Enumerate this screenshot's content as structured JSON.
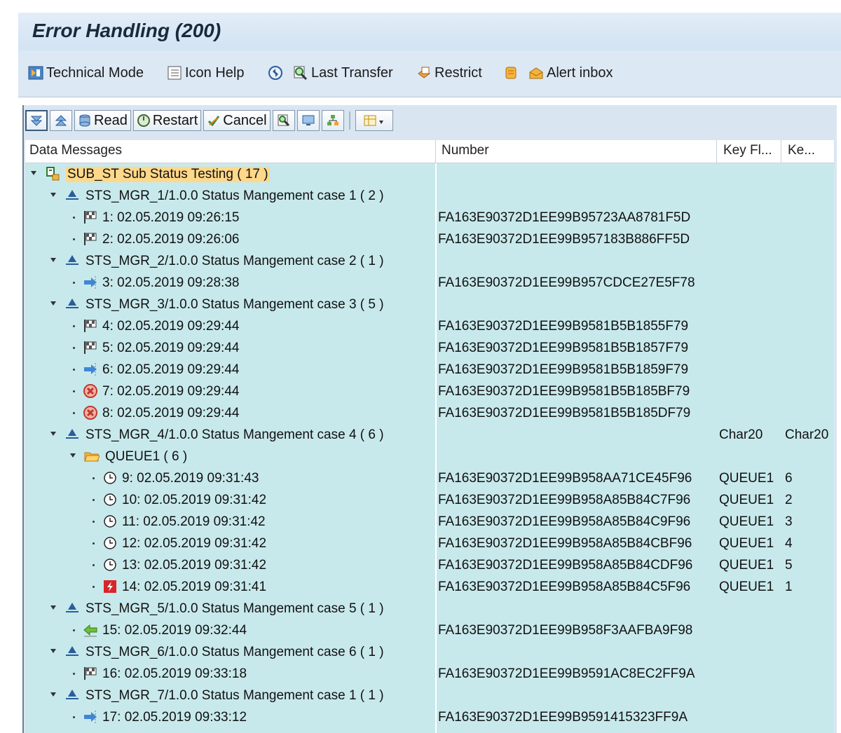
{
  "window": {
    "title": "Error Handling (200)"
  },
  "app_toolbar": {
    "technical_mode": "Technical Mode",
    "icon_help": "Icon Help",
    "last_transfer": "Last Transfer",
    "restrict": "Restrict",
    "alert_inbox": "Alert inbox"
  },
  "grid_toolbar": {
    "read": "Read",
    "restart": "Restart",
    "cancel": "Cancel"
  },
  "columns": {
    "data_messages": "Data Messages",
    "number": "Number",
    "key_fl": "Key Fl...",
    "ke": "Ke..."
  },
  "colors": {
    "highlight": "#ffd88a",
    "row_bg": "#c8e9ec",
    "error": "#d9432f"
  },
  "tree": {
    "root": "SUB_ST Sub Status Testing ( 17  )",
    "g1": "STS_MGR_1/1.0.0 Status Mangement case 1 ( 2  )",
    "g2": "STS_MGR_2/1.0.0 Status Mangement case 2 ( 1  )",
    "g3": "STS_MGR_3/1.0.0 Status Mangement case 3 ( 5  )",
    "g4": "STS_MGR_4/1.0.0 Status Mangement case 4 ( 6  )",
    "g4_key1": "Char20",
    "g4_key2": "Char20",
    "queue": "QUEUE1 ( 6  )",
    "g5": "STS_MGR_5/1.0.0 Status Mangement case 5 ( 1  )",
    "g6": "STS_MGR_6/1.0.0 Status Mangement case 6 ( 1  )",
    "g7": "STS_MGR_7/1.0.0 Status Mangement case 1 ( 1  )"
  },
  "messages": [
    {
      "label": "1: 02.05.2019 09:26:15",
      "number": "FA163E90372D1EE99B95723AA8781F5D",
      "icon": "flag-icon"
    },
    {
      "label": "2: 02.05.2019 09:26:06",
      "number": "FA163E90372D1EE99B957183B886FF5D",
      "icon": "flag-icon"
    },
    {
      "label": "3: 02.05.2019 09:28:38",
      "number": "FA163E90372D1EE99B957CDCE27E5F78",
      "icon": "forward-arrow-icon"
    },
    {
      "label": "4: 02.05.2019 09:29:44",
      "number": "FA163E90372D1EE99B9581B5B1855F79",
      "icon": "flag-icon"
    },
    {
      "label": "5: 02.05.2019 09:29:44",
      "number": "FA163E90372D1EE99B9581B5B1857F79",
      "icon": "flag-icon"
    },
    {
      "label": "6: 02.05.2019 09:29:44",
      "number": "FA163E90372D1EE99B9581B5B1859F79",
      "icon": "forward-arrow-icon"
    },
    {
      "label": "7: 02.05.2019 09:29:44",
      "number": "FA163E90372D1EE99B9581B5B185BF79",
      "icon": "cancelled-icon"
    },
    {
      "label": "8: 02.05.2019 09:29:44",
      "number": "FA163E90372D1EE99B9581B5B185DF79",
      "icon": "cancelled-icon"
    },
    {
      "label": "9: 02.05.2019 09:31:43",
      "number": "FA163E90372D1EE99B958AA71CE45F96",
      "icon": "clock-icon",
      "k1": "QUEUE1",
      "k2": "6"
    },
    {
      "label": "10: 02.05.2019 09:31:42",
      "number": "FA163E90372D1EE99B958A85B84C7F96",
      "icon": "clock-icon",
      "k1": "QUEUE1",
      "k2": "2"
    },
    {
      "label": "11: 02.05.2019 09:31:42",
      "number": "FA163E90372D1EE99B958A85B84C9F96",
      "icon": "clock-icon",
      "k1": "QUEUE1",
      "k2": "3"
    },
    {
      "label": "12: 02.05.2019 09:31:42",
      "number": "FA163E90372D1EE99B958A85B84CBF96",
      "icon": "clock-icon",
      "k1": "QUEUE1",
      "k2": "4"
    },
    {
      "label": "13: 02.05.2019 09:31:42",
      "number": "FA163E90372D1EE99B958A85B84CDF96",
      "icon": "clock-icon",
      "k1": "QUEUE1",
      "k2": "5"
    },
    {
      "label": "14: 02.05.2019 09:31:41",
      "number": "FA163E90372D1EE99B958A85B84C5F96",
      "icon": "error-icon",
      "k1": "QUEUE1",
      "k2": "1"
    },
    {
      "label": "15: 02.05.2019 09:32:44",
      "number": "FA163E90372D1EE99B958F3AAFBA9F98",
      "icon": "return-arrow-icon"
    },
    {
      "label": "16: 02.05.2019 09:33:18",
      "number": "FA163E90372D1EE99B9591AC8EC2FF9A",
      "icon": "flag-icon"
    },
    {
      "label": "17: 02.05.2019 09:33:12",
      "number": "FA163E90372D1EE99B9591415323FF9A",
      "icon": "forward-arrow-icon"
    }
  ]
}
